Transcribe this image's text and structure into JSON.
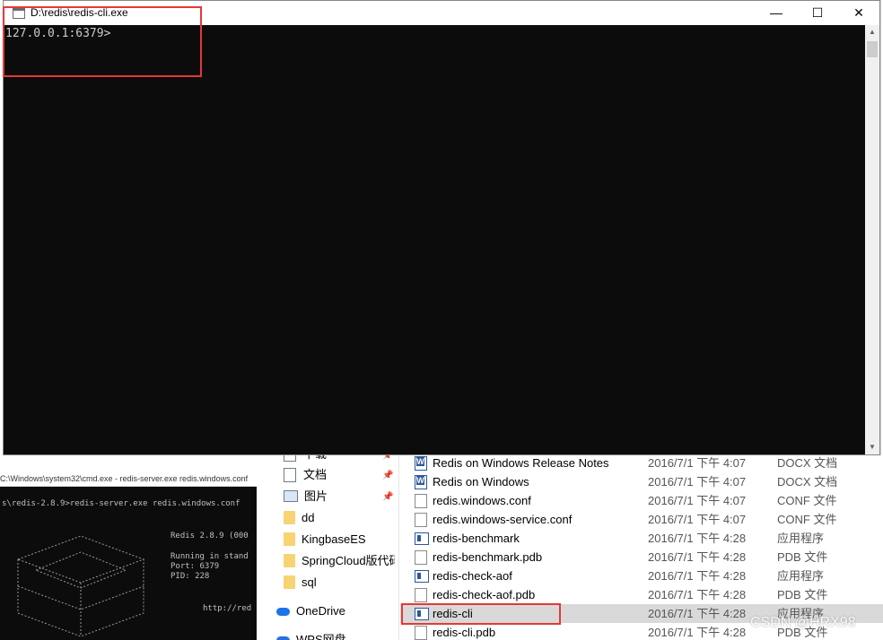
{
  "cli_window": {
    "title": "D:\\redis\\redis-cli.exe",
    "minimize": "—",
    "maximize": "☐",
    "close": "✕",
    "prompt": "127.0.0.1:6379>"
  },
  "cmd_window": {
    "title": "C:\\Windows\\system32\\cmd.exe - redis-server.exe  redis.windows.conf",
    "command_line": "s\\redis-2.8.9>redis-server.exe redis.windows.conf",
    "banner_version": "Redis 2.8.9 (000",
    "banner_mode": "Running in stand",
    "banner_port": "Port: 6379",
    "banner_pid": "PID: 228",
    "banner_url": "http://red"
  },
  "explorer": {
    "nav": [
      {
        "label": "下载",
        "icon": "download-icon",
        "pinned": true
      },
      {
        "label": "文档",
        "icon": "document-icon",
        "pinned": true
      },
      {
        "label": "图片",
        "icon": "picture-icon",
        "pinned": true
      },
      {
        "label": "dd",
        "icon": "folder-icon"
      },
      {
        "label": "KingbaseES",
        "icon": "folder-icon"
      },
      {
        "label": "SpringCloud版代码",
        "icon": "folder-icon"
      },
      {
        "label": "sql",
        "icon": "folder-icon"
      },
      {
        "label": "OneDrive",
        "icon": "onedrive-icon"
      },
      {
        "label": "WPS网盘",
        "icon": "wps-icon"
      }
    ],
    "files": [
      {
        "name": "Redis on Windows Release Notes",
        "date": "2016/7/1 下午 4:07",
        "type": "DOCX 文档",
        "icon": "word-icon"
      },
      {
        "name": "Redis on Windows",
        "date": "2016/7/1 下午 4:07",
        "type": "DOCX 文档",
        "icon": "word-icon"
      },
      {
        "name": "redis.windows.conf",
        "date": "2016/7/1 下午 4:07",
        "type": "CONF 文件",
        "icon": "file-icon"
      },
      {
        "name": "redis.windows-service.conf",
        "date": "2016/7/1 下午 4:07",
        "type": "CONF 文件",
        "icon": "file-icon"
      },
      {
        "name": "redis-benchmark",
        "date": "2016/7/1 下午 4:28",
        "type": "应用程序",
        "icon": "exe-icon"
      },
      {
        "name": "redis-benchmark.pdb",
        "date": "2016/7/1 下午 4:28",
        "type": "PDB 文件",
        "icon": "file-icon"
      },
      {
        "name": "redis-check-aof",
        "date": "2016/7/1 下午 4:28",
        "type": "应用程序",
        "icon": "exe-icon"
      },
      {
        "name": "redis-check-aof.pdb",
        "date": "2016/7/1 下午 4:28",
        "type": "PDB 文件",
        "icon": "file-icon"
      },
      {
        "name": "redis-cli",
        "date": "2016/7/1 下午 4:28",
        "type": "应用程序",
        "icon": "exe-icon",
        "selected": true
      },
      {
        "name": "redis-cli.pdb",
        "date": "2016/7/1 下午 4:28",
        "type": "PDB 文件",
        "icon": "file-icon"
      }
    ]
  },
  "watermark": "CSDN @HRX98",
  "colors": {
    "console_bg": "#0c0c0c",
    "annotation": "#e53935",
    "selection": "#d9d9d9"
  }
}
